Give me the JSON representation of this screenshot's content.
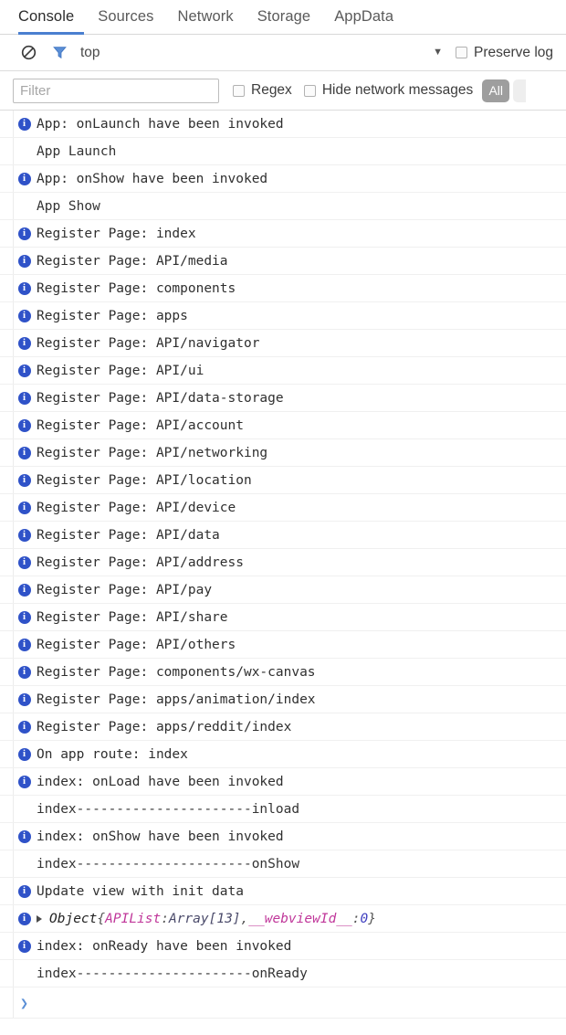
{
  "tabs": [
    {
      "label": "Console",
      "active": true
    },
    {
      "label": "Sources",
      "active": false
    },
    {
      "label": "Network",
      "active": false
    },
    {
      "label": "Storage",
      "active": false
    },
    {
      "label": "AppData",
      "active": false
    }
  ],
  "toolbar": {
    "clear_icon": "clear-console-icon",
    "filter_icon": "funnel-filter-icon",
    "context_label": "top",
    "context_caret": "▼",
    "preserve_log_label": "Preserve log",
    "preserve_log_checked": false
  },
  "filterbar": {
    "filter_placeholder": "Filter",
    "filter_value": "",
    "regex_label": "Regex",
    "regex_checked": false,
    "hide_network_label": "Hide network messages",
    "hide_network_checked": false,
    "level_label": "All"
  },
  "accent": {
    "tab_underline": "#4a7fd0",
    "info_icon": "#2f52c8",
    "filter_icon": "#5b8fd6",
    "object_key": "#c0379a",
    "prompt": "#5b8fd6"
  },
  "messages": [
    {
      "icon": "info",
      "text": "App: onLaunch have been invoked"
    },
    {
      "icon": "none",
      "text": "App Launch"
    },
    {
      "icon": "info",
      "text": "App: onShow have been invoked"
    },
    {
      "icon": "none",
      "text": "App Show"
    },
    {
      "icon": "info",
      "text": "Register Page: index"
    },
    {
      "icon": "info",
      "text": "Register Page: API/media"
    },
    {
      "icon": "info",
      "text": "Register Page: components"
    },
    {
      "icon": "info",
      "text": "Register Page: apps"
    },
    {
      "icon": "info",
      "text": "Register Page: API/navigator"
    },
    {
      "icon": "info",
      "text": "Register Page: API/ui"
    },
    {
      "icon": "info",
      "text": "Register Page: API/data-storage"
    },
    {
      "icon": "info",
      "text": "Register Page: API/account"
    },
    {
      "icon": "info",
      "text": "Register Page: API/networking"
    },
    {
      "icon": "info",
      "text": "Register Page: API/location"
    },
    {
      "icon": "info",
      "text": "Register Page: API/device"
    },
    {
      "icon": "info",
      "text": "Register Page: API/data"
    },
    {
      "icon": "info",
      "text": "Register Page: API/address"
    },
    {
      "icon": "info",
      "text": "Register Page: API/pay"
    },
    {
      "icon": "info",
      "text": "Register Page: API/share"
    },
    {
      "icon": "info",
      "text": "Register Page: API/others"
    },
    {
      "icon": "info",
      "text": "Register Page: components/wx-canvas"
    },
    {
      "icon": "info",
      "text": "Register Page: apps/animation/index"
    },
    {
      "icon": "info",
      "text": "Register Page: apps/reddit/index"
    },
    {
      "icon": "info",
      "text": "On app route: index"
    },
    {
      "icon": "info",
      "text": "index: onLoad have been invoked"
    },
    {
      "icon": "none",
      "text": "index----------------------inload"
    },
    {
      "icon": "info",
      "text": "index: onShow have been invoked"
    },
    {
      "icon": "none",
      "text": "index----------------------onShow"
    },
    {
      "icon": "info",
      "text": "Update view with init data"
    }
  ],
  "object_row": {
    "icon": "info",
    "disclosure": "collapsed",
    "name": "Object",
    "open_brace": " {",
    "key1": "APIList",
    "sep1": ": ",
    "val1": "Array[13]",
    "comma": ", ",
    "key2": "__webviewId__",
    "sep2": ": ",
    "val2": "0",
    "close_brace": "}"
  },
  "messages_after": [
    {
      "icon": "info",
      "text": "index: onReady have been invoked"
    },
    {
      "icon": "none",
      "text": "index----------------------onReady"
    }
  ],
  "prompt": {
    "chevron": "❯",
    "value": ""
  }
}
